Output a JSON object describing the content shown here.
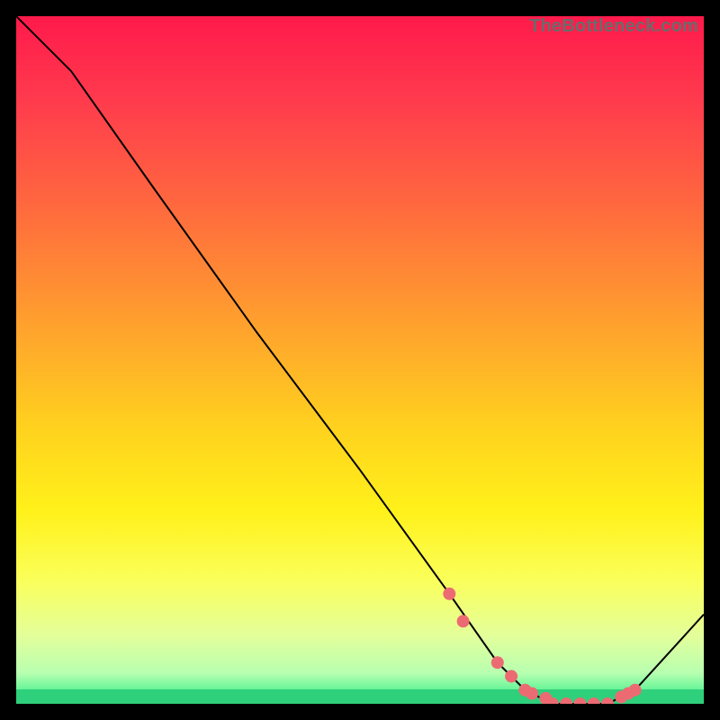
{
  "watermark": "TheBottleneck.com",
  "colors": {
    "frame": "#000000",
    "curve": "#000000",
    "marker_fill": "#ec6b72",
    "marker_stroke": "#ec6b72",
    "zero_band": "#2fd07b",
    "gradient_stops": [
      {
        "offset": 0.0,
        "color": "#ff1a4b"
      },
      {
        "offset": 0.12,
        "color": "#ff3a4d"
      },
      {
        "offset": 0.28,
        "color": "#ff6a3e"
      },
      {
        "offset": 0.44,
        "color": "#ff9e2e"
      },
      {
        "offset": 0.6,
        "color": "#ffd21e"
      },
      {
        "offset": 0.72,
        "color": "#fff11a"
      },
      {
        "offset": 0.82,
        "color": "#faff5a"
      },
      {
        "offset": 0.9,
        "color": "#e4ff9a"
      },
      {
        "offset": 0.955,
        "color": "#b8ffb0"
      },
      {
        "offset": 0.978,
        "color": "#6cf59a"
      },
      {
        "offset": 1.0,
        "color": "#20d27a"
      }
    ]
  },
  "chart_data": {
    "type": "line",
    "title": "",
    "xlabel": "",
    "ylabel": "",
    "xlim": [
      0,
      100
    ],
    "ylim": [
      0,
      100
    ],
    "x": [
      0,
      8,
      20,
      35,
      50,
      63,
      70,
      74,
      78,
      82,
      86,
      90,
      100
    ],
    "values": [
      100,
      92,
      75,
      54,
      34,
      16,
      6,
      2,
      0,
      0,
      0,
      2,
      13
    ],
    "marker_points": {
      "x": [
        63,
        65,
        70,
        72,
        74,
        75,
        77,
        78,
        80,
        82,
        84,
        86,
        88,
        89,
        90
      ],
      "y": [
        16,
        12,
        6,
        4,
        2,
        1.5,
        0.8,
        0,
        0,
        0,
        0,
        0,
        1,
        1.5,
        2
      ]
    },
    "notes": "Bottleneck-style curve. y=0 band shown as green strip. Curve has knee near x≈8 then descends roughly linearly to a flat minimum around x≈78–86, then rises again."
  }
}
